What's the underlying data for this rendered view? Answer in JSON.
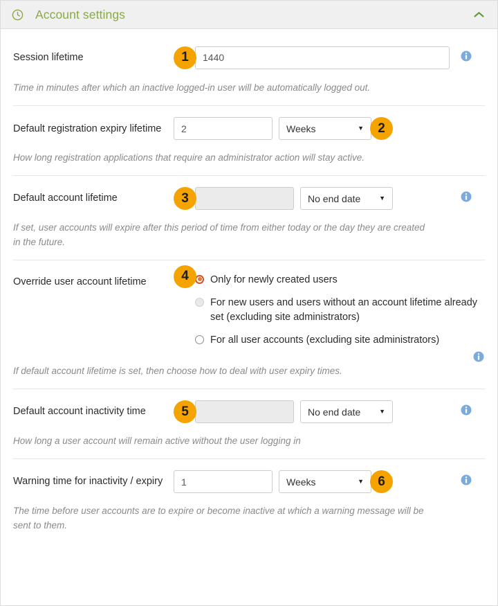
{
  "header": {
    "title": "Account settings",
    "clock_icon": "clock-icon",
    "collapse_icon": "chevron-up-icon",
    "accent_color": "#8aa84b"
  },
  "badge_color": "#f5a300",
  "info_icon_color": "#7babdd",
  "fields": [
    {
      "badge": "1",
      "label": "Session lifetime",
      "value": "1440",
      "help": "Time in minutes after which an inactive logged-in user will be automatically logged out.",
      "has_info": true,
      "disabled": false
    },
    {
      "badge": "2",
      "label": "Default registration expiry lifetime",
      "value": "2",
      "unit": "Weeks",
      "help": "How long registration applications that require an administrator action will stay active.",
      "has_info": false,
      "disabled": false
    },
    {
      "badge": "3",
      "label": "Default account lifetime",
      "value": "",
      "unit": "No end date",
      "help": "If set, user accounts will expire after this period of time from either today or the day they are created in the future.",
      "has_info": true,
      "disabled": true
    },
    {
      "badge": "4",
      "label": "Override user account lifetime",
      "help": "If default account lifetime is set, then choose how to deal with user expiry times.",
      "has_info": true,
      "options": [
        {
          "label": "Only for newly created users",
          "state": "checked"
        },
        {
          "label": "For new users and users without an account lifetime already set (excluding site administrators)",
          "state": "disabled"
        },
        {
          "label": "For all user accounts (excluding site administrators)",
          "state": "unchecked"
        }
      ]
    },
    {
      "badge": "5",
      "label": "Default account inactivity time",
      "value": "",
      "unit": "No end date",
      "help": "How long a user account will remain active without the user logging in",
      "has_info": true,
      "disabled": true
    },
    {
      "badge": "6",
      "label": "Warning time for inactivity / expiry",
      "value": "1",
      "unit": "Weeks",
      "help": "The time before user accounts are to expire or become inactive at which a warning message will be sent to them.",
      "has_info": true,
      "disabled": false
    }
  ],
  "caret_glyph": "▼"
}
